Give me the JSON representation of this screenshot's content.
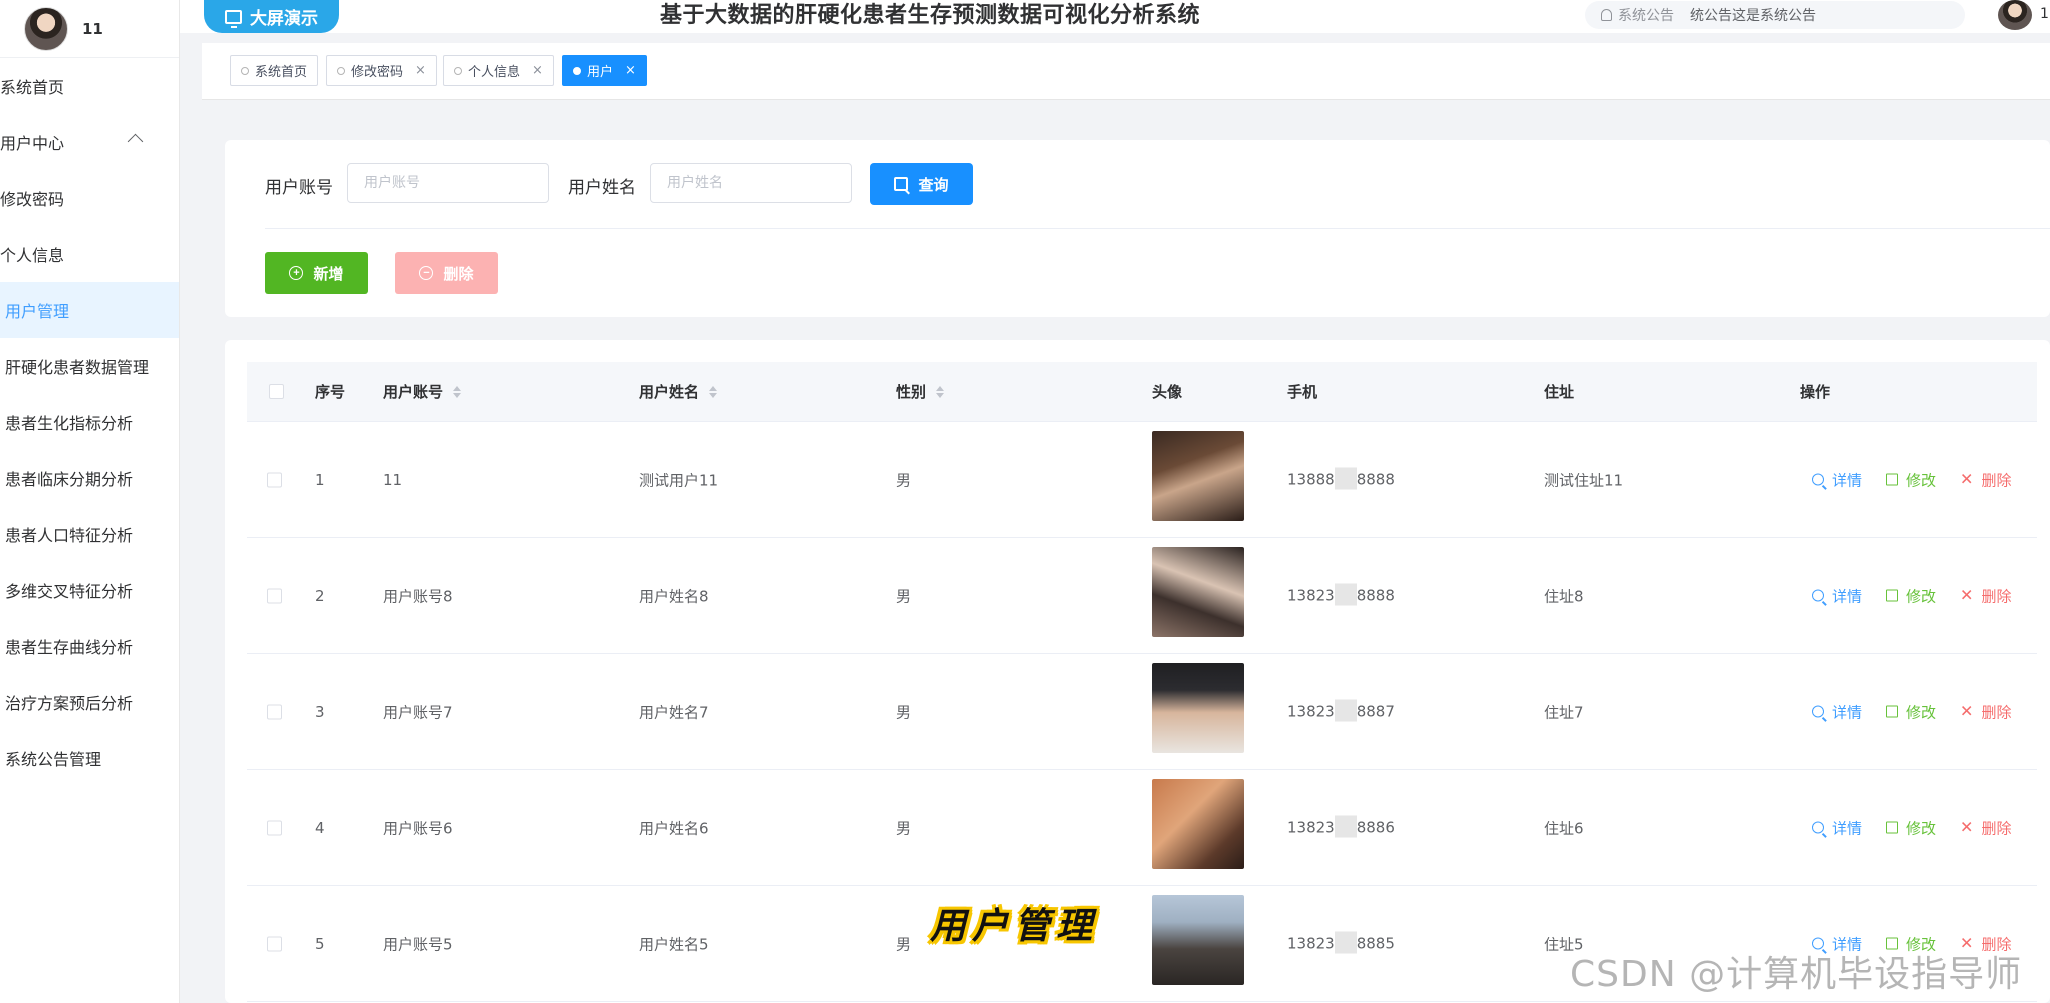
{
  "sidebar": {
    "user_name": "11",
    "items": [
      {
        "label": "系统首页"
      },
      {
        "label": "用户中心"
      },
      {
        "label": "修改密码"
      },
      {
        "label": "个人信息"
      },
      {
        "label": "用户管理"
      },
      {
        "label": "肝硬化患者数据管理"
      },
      {
        "label": "患者生化指标分析"
      },
      {
        "label": "患者临床分期分析"
      },
      {
        "label": "患者人口特征分析"
      },
      {
        "label": "多维交叉特征分析"
      },
      {
        "label": "患者生存曲线分析"
      },
      {
        "label": "治疗方案预后分析"
      },
      {
        "label": "系统公告管理"
      }
    ]
  },
  "header": {
    "bigscreen_label": "大屏演示",
    "title": "基于大数据的肝硬化患者生存预测数据可视化分析系统",
    "notice_label": "系统公告",
    "notice_text": "统公告这是系统公告",
    "user_name": "1"
  },
  "tags": [
    {
      "label": "系统首页"
    },
    {
      "label": "修改密码",
      "close": "×"
    },
    {
      "label": "个人信息",
      "close": "×"
    },
    {
      "label": "用户",
      "close": "×"
    }
  ],
  "search": {
    "account_label": "用户账号",
    "account_placeholder": "用户账号",
    "name_label": "用户姓名",
    "name_placeholder": "用户姓名",
    "query_label": "查询",
    "add_label": "新增",
    "delete_label": "删除"
  },
  "table": {
    "headers": {
      "index": "序号",
      "account": "用户账号",
      "name": "用户姓名",
      "gender": "性别",
      "avatar": "头像",
      "phone": "手机",
      "address": "住址",
      "ops": "操作"
    },
    "actions": {
      "detail": "详情",
      "edit": "修改",
      "delete": "删除"
    },
    "rows": [
      {
        "index": "1",
        "account": "11",
        "name": "测试用户11",
        "gender": "男",
        "phone_a": "13888",
        "phone_b": "8888",
        "address": "测试住址11"
      },
      {
        "index": "2",
        "account": "用户账号8",
        "name": "用户姓名8",
        "gender": "男",
        "phone_a": "13823",
        "phone_b": "8888",
        "address": "住址8"
      },
      {
        "index": "3",
        "account": "用户账号7",
        "name": "用户姓名7",
        "gender": "男",
        "phone_a": "13823",
        "phone_b": "8887",
        "address": "住址7"
      },
      {
        "index": "4",
        "account": "用户账号6",
        "name": "用户姓名6",
        "gender": "男",
        "phone_a": "13823",
        "phone_b": "8886",
        "address": "住址6"
      },
      {
        "index": "5",
        "account": "用户账号5",
        "name": "用户姓名5",
        "gender": "男",
        "phone_a": "13823",
        "phone_b": "8885",
        "address": "住址5"
      }
    ]
  },
  "overlay": {
    "caption": "用户管理",
    "watermark": "CSDN @计算机毕设指导师"
  },
  "colors": {
    "primary": "#1890ff",
    "success": "#52b623",
    "danger": "#f56c6c",
    "sidebar_active_bg": "#e8f4ff"
  }
}
